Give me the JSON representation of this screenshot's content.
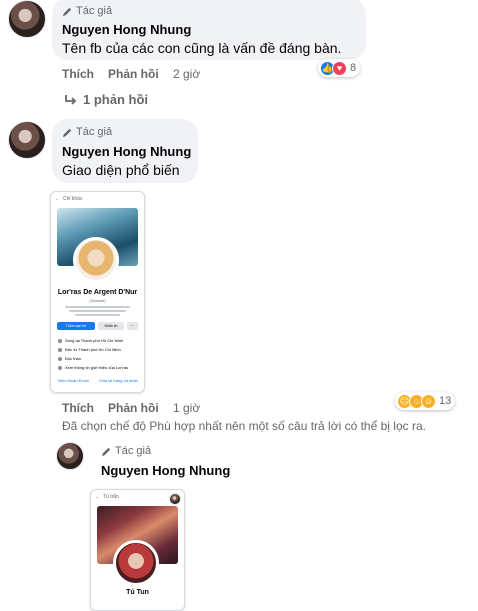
{
  "author_tag": "Tác giả",
  "comments": [
    {
      "name": "Nguyen Hong Nhung",
      "text": "Tên fb của các con cũng là vấn đề đáng bàn.",
      "like": "Thích",
      "reply": "Phản hồi",
      "time": "2 giờ",
      "reaction_count": "8",
      "reaction_icons": [
        "like-icon",
        "love-icon"
      ],
      "replies_link": "1 phản hồi"
    },
    {
      "name": "Nguyen Hong Nhung",
      "text": "Giao diện phổ biến",
      "like": "Thích",
      "reply": "Phản hồi",
      "time": "1 giờ",
      "reaction_count": "13",
      "reaction_icons": [
        "sad-icon",
        "wow-icon",
        "haha-icon"
      ],
      "notice": "Đã chọn chế độ Phù hợp nhất nên một số câu trả lời có thể bị lọc ra.",
      "attachment": {
        "top_bar": "Chỉ khác",
        "profile_name": "Lor'ras De Argent D'Nur",
        "profile_sub": "(Samuel)",
        "btn_primary": "Thêm bạn bè",
        "btn_secondary": "Nhắn tin",
        "btn_more": "···",
        "rows": [
          "Sống tại Thành phố Hồ Chí Minh",
          "Đến từ Thành phố Hồ Chí Minh",
          "Độc thân",
          "Xem thông tin giới thiệu của Lor'ras"
        ],
        "tab1": "Nhìn thuận Email",
        "tab2": "Chia sẻ trang cá nhân"
      }
    },
    {
      "name": "Nguyen Hong Nhung",
      "attachment": {
        "top_bar": "Tú trắn",
        "profile_name": "Tú Tun"
      }
    }
  ],
  "colors": {
    "bubble": "#f0f2f5",
    "secondary_text": "#65676b",
    "like_blue": "#1877f2",
    "love_red": "#f33e58",
    "emoji_yellow": "#f7b125"
  }
}
